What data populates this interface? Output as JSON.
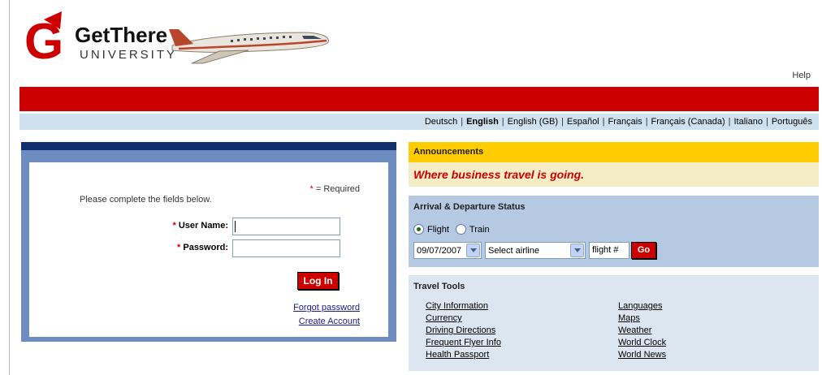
{
  "header": {
    "logo_text": "GetThere",
    "logo_subtext": "UNIVERSITY",
    "logo_mark": "G",
    "help_label": "Help"
  },
  "languages": {
    "items": [
      "Deutsch",
      "English",
      "English (GB)",
      "Español",
      "Français",
      "Français (Canada)",
      "Italiano",
      "Português"
    ],
    "active": "English",
    "separator": "|"
  },
  "login": {
    "required_star": "*",
    "required_note": " = Required",
    "instructions": "Please complete the fields below.",
    "username_label": "User Name:",
    "password_label": "Password:",
    "username_value": "",
    "password_value": "",
    "login_button": "Log In",
    "forgot_password": "Forgot password",
    "create_account": "Create Account"
  },
  "announcements": {
    "title": "Announcements",
    "message": "Where business travel is going."
  },
  "status": {
    "title": "Arrival & Departure Status",
    "mode_options": [
      "Flight",
      "Train"
    ],
    "selected_mode": "Flight",
    "date": "09/07/2007",
    "airline_select": "Select airline",
    "flight_placeholder": "flight #",
    "go_button": "Go"
  },
  "tools": {
    "title": "Travel Tools",
    "col1": [
      "City Information",
      "Currency",
      "Driving Directions",
      "Frequent Flyer Info",
      "Health Passport"
    ],
    "col2": [
      "Languages",
      "Maps",
      "Weather",
      "World Clock",
      "World News"
    ]
  },
  "colors": {
    "brand_red": "#cc0000",
    "navy": "#0f2f6e",
    "login_frame": "#6d8cc0",
    "lang_bar": "#cfe0ee",
    "announce_yellow": "#ffcc00",
    "announce_body": "#f4edc6",
    "status_panel": "#b5c9e2",
    "tools_panel": "#dce6f1"
  }
}
